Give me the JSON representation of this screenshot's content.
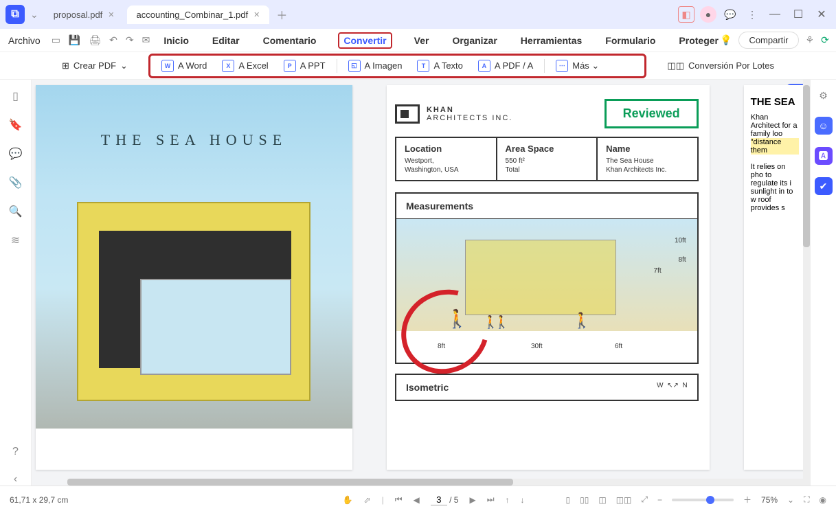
{
  "titlebar": {
    "tabs": [
      {
        "label": "proposal.pdf",
        "active": false
      },
      {
        "label": "accounting_Combinar_1.pdf",
        "active": true
      }
    ]
  },
  "menubar": {
    "file": "Archivo",
    "items": [
      "Inicio",
      "Editar",
      "Comentario",
      "Convertir",
      "Ver",
      "Organizar",
      "Herramientas",
      "Formulario",
      "Proteger"
    ],
    "highlighted_index": 3,
    "share": "Compartir"
  },
  "subtoolbar": {
    "create_pdf": "Crear PDF",
    "convert_buttons": [
      {
        "icon": "W",
        "label": "A Word"
      },
      {
        "icon": "X",
        "label": "A Excel"
      },
      {
        "icon": "P",
        "label": "A PPT"
      },
      {
        "icon": "◱",
        "label": "A Imagen"
      },
      {
        "icon": "T",
        "label": "A Texto"
      },
      {
        "icon": "A",
        "label": "A PDF / A"
      },
      {
        "icon": "⋯",
        "label": "Más"
      }
    ],
    "batch": "Conversión Por Lotes"
  },
  "document": {
    "page1": {
      "title": "THE SEA HOUSE"
    },
    "page2": {
      "brand_line1": "KHAN",
      "brand_line2": "ARCHITECTS INC.",
      "reviewed": "Reviewed",
      "info": [
        {
          "label": "Location",
          "value": "Westport,\nWashington, USA"
        },
        {
          "label": "Area Space",
          "value": "550 ft²\nTotal"
        },
        {
          "label": "Name",
          "value": "The Sea House\nKhan Architects Inc."
        }
      ],
      "measurements_title": "Measurements",
      "dims": {
        "w": "30ft",
        "left": "8ft",
        "right": "6ft",
        "h1": "10ft",
        "h2": "8ft",
        "h3": "7ft"
      },
      "iso_title": "Isometric",
      "compass_w": "W",
      "compass_n": "N"
    },
    "page3": {
      "title": "THE SEA",
      "p1": "Khan Architect for a family loo",
      "hl": "\"distance them",
      "p2": "It relies on pho to regulate its i sunlight in to w roof provides s"
    }
  },
  "statusbar": {
    "docsize": "61,71 x 29,7 cm",
    "page_current": "3",
    "page_total": "/ 5",
    "zoom": "75%"
  }
}
